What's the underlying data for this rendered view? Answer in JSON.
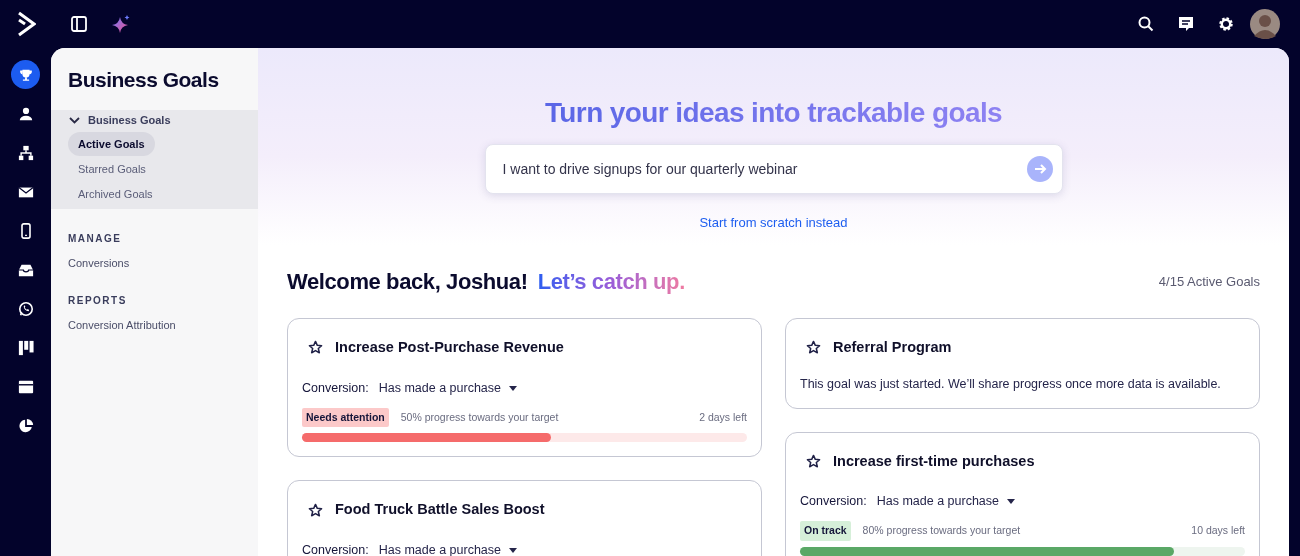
{
  "nav_rail": [
    {
      "selected": true
    },
    {
      "selected": false
    },
    {
      "selected": false
    },
    {
      "selected": false
    },
    {
      "selected": false
    },
    {
      "selected": false
    },
    {
      "selected": false
    },
    {
      "selected": false
    },
    {
      "selected": false
    },
    {
      "selected": false
    }
  ],
  "sidebar": {
    "title": "Business Goals",
    "groups": [
      {
        "label": "Business Goals",
        "expanded": true,
        "children": [
          {
            "label": "Active Goals",
            "selected": true
          },
          {
            "label": "Starred Goals",
            "selected": false
          },
          {
            "label": "Archived Goals",
            "selected": false
          }
        ]
      }
    ],
    "sections": [
      {
        "heading": "MANAGE",
        "items": [
          {
            "label": "Conversions"
          }
        ]
      },
      {
        "heading": "REPORTS",
        "items": [
          {
            "label": "Conversion Attribution"
          }
        ]
      }
    ]
  },
  "hero": {
    "headline": "Turn your ideas into trackable goals",
    "prompt": {
      "value": "I want to drive signups for our quarterly webinar"
    },
    "link": "Start from scratch instead"
  },
  "welcome": {
    "greeting": "Welcome back, Joshua!",
    "tagline": "Let’s catch up.",
    "count": "4/15 Active Goals"
  },
  "columns": [
    {
      "cards": [
        {
          "title": "Increase Post-Purchase Revenue",
          "starred": false,
          "conversion_label": "Conversion:",
          "conversion": "Has made a purchase",
          "status": {
            "kind": "attention",
            "label": "Needs attention"
          },
          "progress_text": "50% progress towards your target",
          "days_left": "2 days left",
          "level": 0.56
        },
        {
          "title": "Food Truck Battle Sales Boost",
          "starred": false,
          "conversion_label": "Conversion:",
          "conversion": "Has made a purchase"
        }
      ]
    },
    {
      "cards": [
        {
          "title": "Referral Program",
          "starred": false,
          "message": "This goal was just started. We’ll share progress once more data is available."
        },
        {
          "title": "Increase first-time purchases",
          "starred": false,
          "conversion_label": "Conversion:",
          "conversion": "Has made a purchase",
          "status": {
            "kind": "on_track",
            "label": "On track"
          },
          "progress_text": "80% progress towards your target",
          "days_left": "10 days left",
          "level": 0.84
        }
      ]
    }
  ]
}
